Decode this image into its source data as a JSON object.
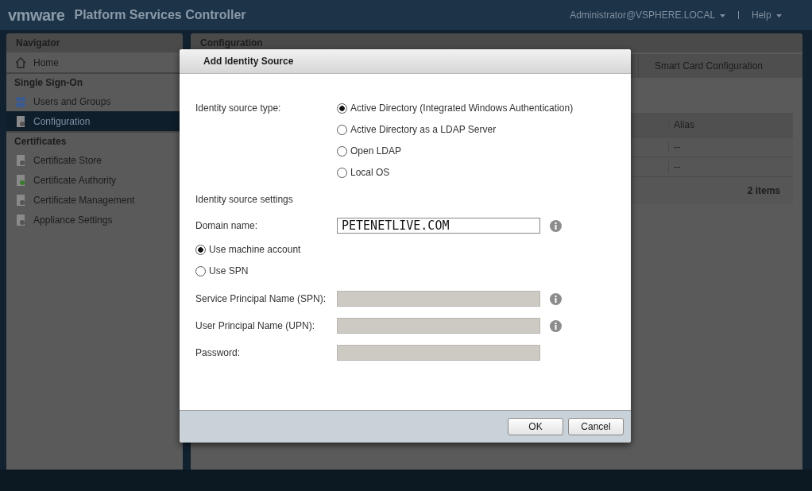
{
  "header": {
    "logo": "vmware",
    "title": "Platform Services Controller",
    "user": "Administrator@VSPHERE.LOCAL",
    "help": "Help"
  },
  "navigator": {
    "title": "Navigator",
    "items": [
      {
        "kind": "link",
        "label": "Home",
        "selected": false
      },
      {
        "kind": "section",
        "label": "Single Sign-On"
      },
      {
        "kind": "link",
        "label": "Users and Groups",
        "selected": false
      },
      {
        "kind": "link",
        "label": "Configuration",
        "selected": true
      },
      {
        "kind": "section",
        "label": "Certificates"
      },
      {
        "kind": "link",
        "label": "Certificate Store",
        "selected": false
      },
      {
        "kind": "link",
        "label": "Certificate Authority",
        "selected": false
      },
      {
        "kind": "link",
        "label": "Certificate Management",
        "selected": false
      },
      {
        "kind": "link",
        "label": "Appliance Settings",
        "selected": false
      }
    ]
  },
  "content": {
    "title": "Configuration",
    "tabs": [
      {
        "label": "Smart Card Configuration",
        "selected": false
      }
    ],
    "table": {
      "columns": [
        "Alias"
      ],
      "rows": [
        [
          "--"
        ],
        [
          "--"
        ]
      ],
      "footer": "2 items"
    }
  },
  "dialog": {
    "title": "Add Identity Source",
    "type_label": "Identity source type:",
    "types": [
      {
        "label": "Active Directory (Integrated Windows Authentication)",
        "selected": true
      },
      {
        "label": "Active Directory as a LDAP Server",
        "selected": false
      },
      {
        "label": "Open LDAP",
        "selected": false
      },
      {
        "label": "Local OS",
        "selected": false
      }
    ],
    "settings_heading": "Identity source settings",
    "domain": {
      "label": "Domain name:",
      "value": "PETENETLIVE.COM"
    },
    "accounts": [
      {
        "label": "Use machine account",
        "selected": true
      },
      {
        "label": "Use SPN",
        "selected": false
      }
    ],
    "fields": [
      {
        "label": "Service Principal Name (SPN):",
        "disabled": true,
        "info": true
      },
      {
        "label": "User Principal Name (UPN):",
        "disabled": true,
        "info": true
      },
      {
        "label": "Password:",
        "disabled": true,
        "info": false
      }
    ],
    "buttons": [
      "OK",
      "Cancel"
    ]
  }
}
